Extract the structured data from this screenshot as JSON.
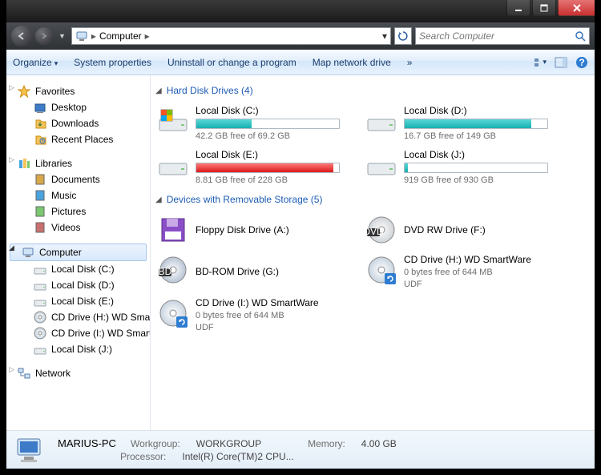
{
  "titlebar": {},
  "address": {
    "root_icon": "computer-icon",
    "crumb": "Computer",
    "search_placeholder": "Search Computer"
  },
  "cmdbar": {
    "organize": "Organize",
    "sysprops": "System properties",
    "uninstall": "Uninstall or change a program",
    "mapdrive": "Map network drive",
    "more": "»"
  },
  "sidebar": {
    "favorites": {
      "label": "Favorites",
      "items": [
        "Desktop",
        "Downloads",
        "Recent Places"
      ]
    },
    "libraries": {
      "label": "Libraries",
      "items": [
        "Documents",
        "Music",
        "Pictures",
        "Videos"
      ]
    },
    "computer": {
      "label": "Computer",
      "items": [
        "Local Disk (C:)",
        "Local Disk (D:)",
        "Local Disk (E:)",
        "CD Drive (H:) WD SmartWare",
        "CD Drive (I:) WD SmartWare",
        "Local Disk (J:)"
      ]
    },
    "network": {
      "label": "Network"
    }
  },
  "sections": {
    "hdd": {
      "title": "Hard Disk Drives (4)"
    },
    "rem": {
      "title": "Devices with Removable Storage (5)"
    }
  },
  "hdd": [
    {
      "name": "Local Disk (C:)",
      "free": "42.2 GB free of 69.2 GB",
      "fill_pct": 39,
      "color": "teal",
      "win": true
    },
    {
      "name": "Local Disk (D:)",
      "free": "16.7 GB free of 149 GB",
      "fill_pct": 89,
      "color": "teal"
    },
    {
      "name": "Local Disk (E:)",
      "free": "8.81 GB free of 228 GB",
      "fill_pct": 96,
      "color": "red"
    },
    {
      "name": "Local Disk (J:)",
      "free": "919 GB free of 930 GB",
      "fill_pct": 2,
      "color": "teal"
    }
  ],
  "rem": [
    {
      "name": "Floppy Disk Drive (A:)",
      "kind": "floppy"
    },
    {
      "name": "DVD RW Drive (F:)",
      "kind": "dvd"
    },
    {
      "name": "BD-ROM Drive (G:)",
      "kind": "bd"
    },
    {
      "name": "CD Drive (H:) WD SmartWare",
      "kind": "cd",
      "free": "0 bytes free of 644 MB",
      "fs": "UDF"
    },
    {
      "name": "CD Drive (I:) WD SmartWare",
      "kind": "cd",
      "free": "0 bytes free of 644 MB",
      "fs": "UDF"
    }
  ],
  "details": {
    "pcname": "MARIUS-PC",
    "workgroup_lbl": "Workgroup:",
    "workgroup": "WORKGROUP",
    "memory_lbl": "Memory:",
    "memory": "4.00 GB",
    "processor_lbl": "Processor:",
    "processor": "Intel(R) Core(TM)2 CPU..."
  }
}
